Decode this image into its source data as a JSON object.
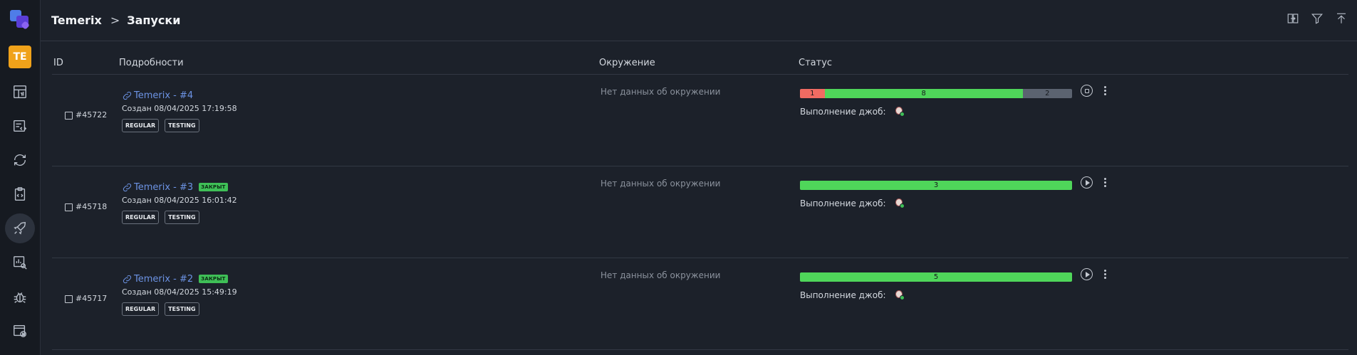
{
  "sidebar": {
    "avatar": "TE",
    "items": [
      {
        "icon": "dashboard-icon"
      },
      {
        "icon": "test-cases-icon"
      },
      {
        "icon": "sync-icon"
      },
      {
        "icon": "test-plan-icon"
      },
      {
        "icon": "launches-rocket-icon",
        "active": true
      },
      {
        "icon": "analytics-search-icon"
      },
      {
        "icon": "bug-icon"
      },
      {
        "icon": "jobs-icon"
      }
    ]
  },
  "header": {
    "project": "Temerix",
    "page": "Запуски",
    "icons": [
      "compare-icon",
      "filter-icon",
      "collapse-top-icon"
    ]
  },
  "table": {
    "columns": {
      "id": "ID",
      "details": "Подробности",
      "env": "Окружение",
      "status": "Статус"
    },
    "rows": [
      {
        "id": "#45722",
        "title": "Temerix - #4",
        "closed": false,
        "created": "Создан 08/04/2025 17:19:58",
        "tags": [
          "REGULAR",
          "TESTING"
        ],
        "env": "Нет данных об окружении",
        "jobs_label": "Выполнение джоб:",
        "action": "stop",
        "bar": [
          {
            "label": "1",
            "value": 1,
            "color": "#f06b62"
          },
          {
            "label": "8",
            "value": 8,
            "color": "#4fd65a"
          },
          {
            "label": "2",
            "value": 2,
            "color": "#5b6370"
          }
        ]
      },
      {
        "id": "#45718",
        "title": "Temerix - #3",
        "closed": true,
        "closed_label": "ЗАКРЫТ",
        "created": "Создан 08/04/2025 16:01:42",
        "tags": [
          "REGULAR",
          "TESTING"
        ],
        "env": "Нет данных об окружении",
        "jobs_label": "Выполнение джоб:",
        "action": "play",
        "bar": [
          {
            "label": "3",
            "value": 3,
            "color": "#4fd65a"
          }
        ]
      },
      {
        "id": "#45717",
        "title": "Temerix - #2",
        "closed": true,
        "closed_label": "ЗАКРЫТ",
        "created": "Создан 08/04/2025 15:49:19",
        "tags": [
          "REGULAR",
          "TESTING"
        ],
        "env": "Нет данных об окружении",
        "jobs_label": "Выполнение джоб:",
        "action": "play",
        "bar": [
          {
            "label": "5",
            "value": 5,
            "color": "#4fd65a"
          }
        ]
      }
    ]
  }
}
